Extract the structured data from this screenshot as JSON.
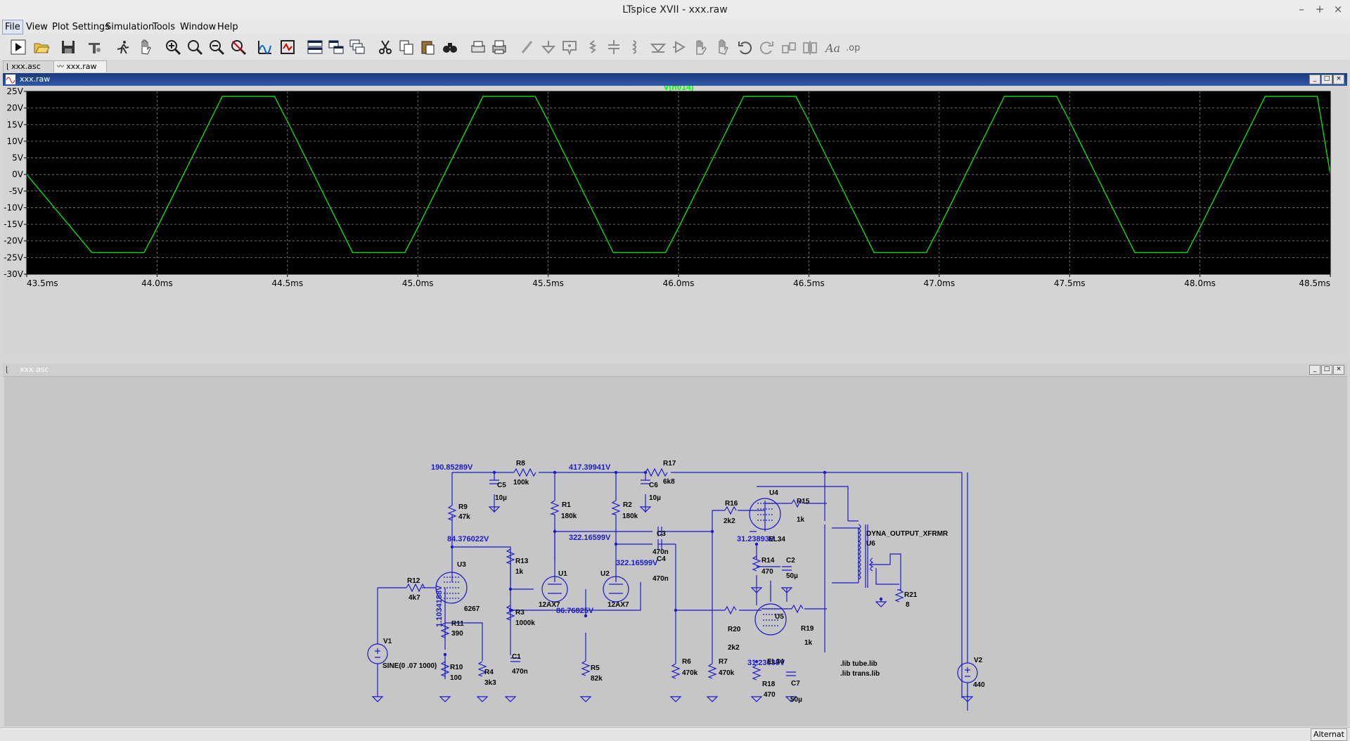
{
  "window": {
    "title": "LTspice XVII - xxx.raw",
    "minimize": "–",
    "maximize": "+",
    "close": "×"
  },
  "menu": [
    "File",
    "View",
    "Plot Settings",
    "Simulation",
    "Tools",
    "Window",
    "Help"
  ],
  "toolbar": {
    "icons": [
      "run-icon",
      "open-icon",
      "save-icon",
      "control-panel-icon",
      "halt-icon",
      "pan-icon",
      "zoom-in-icon",
      "zoom-area-icon",
      "zoom-out-icon",
      "zoom-fit-icon",
      "autorange-icon",
      "plot-settings-icon",
      "tile-horizontal-icon",
      "tile-vertical-icon",
      "cascade-icon",
      "cut-icon",
      "copy-icon",
      "paste-icon",
      "find-icon",
      "print-setup-icon",
      "print-icon",
      "wire-icon",
      "ground-icon",
      "label-net-icon",
      "resistor-icon",
      "capacitor-icon",
      "inductor-icon",
      "diode-icon",
      "component-icon",
      "move-icon",
      "drag-icon",
      "undo-icon",
      "redo-icon",
      "rotate-icon",
      "mirror-icon",
      "text-icon",
      "spice-directive-icon"
    ]
  },
  "tabs": [
    {
      "label": "xxx.asc",
      "active": false
    },
    {
      "label": "xxx.raw",
      "active": true
    }
  ],
  "waveform_window": {
    "title": "xxx.raw",
    "trace_name": "V(n014)",
    "trace_color": "#00ff00"
  },
  "chart_data": {
    "type": "line",
    "title": "V(n014)",
    "xlabel": "",
    "ylabel": "",
    "x_ticks": [
      "43.5ms",
      "44.0ms",
      "44.5ms",
      "45.0ms",
      "45.5ms",
      "46.0ms",
      "46.5ms",
      "47.0ms",
      "47.5ms",
      "48.0ms",
      "48.5ms"
    ],
    "y_ticks": [
      "25V",
      "20V",
      "15V",
      "10V",
      "5V",
      "0V",
      "-5V",
      "-10V",
      "-15V",
      "-20V",
      "-25V",
      "-30V"
    ],
    "xlim": [
      43.5,
      48.5
    ],
    "ylim": [
      -30,
      25
    ],
    "grid": true,
    "series": [
      {
        "name": "V(n014)",
        "color": "#00ff00",
        "x": [
          43.5,
          43.75,
          43.95,
          44.0,
          44.25,
          44.45,
          44.5,
          44.75,
          44.95,
          45.0,
          45.25,
          45.45,
          45.5,
          45.75,
          45.95,
          46.0,
          46.25,
          46.45,
          46.5,
          46.75,
          46.95,
          47.0,
          47.25,
          47.45,
          47.5,
          47.75,
          47.95,
          48.0,
          48.25,
          48.45,
          48.5
        ],
        "y": [
          0,
          -23.5,
          -23.5,
          -16,
          23.5,
          23.5,
          16,
          -23.5,
          -23.5,
          -16,
          23.5,
          23.5,
          16,
          -23.5,
          -23.5,
          -16,
          23.5,
          23.5,
          16,
          -23.5,
          -23.5,
          -16,
          23.5,
          23.5,
          16,
          -23.5,
          -23.5,
          -16,
          23.5,
          23.5,
          0
        ]
      }
    ]
  },
  "schematic_window": {
    "title": "xxx.asc",
    "node_labels": [
      "190.85289V",
      "417.39941V",
      "84.376022V",
      "322.16599V",
      "322.16599V",
      "86.76825V",
      "1.1034188V",
      "31.23893V",
      "31.23638V"
    ],
    "components": [
      {
        "ref": "R8",
        "value": "100k"
      },
      {
        "ref": "C5",
        "value": "10µ"
      },
      {
        "ref": "R17",
        "value": "6k8"
      },
      {
        "ref": "C6",
        "value": "10µ"
      },
      {
        "ref": "R9",
        "value": "47k"
      },
      {
        "ref": "R1",
        "value": "180k"
      },
      {
        "ref": "R2",
        "value": "180k"
      },
      {
        "ref": "R16",
        "value": "2k2"
      },
      {
        "ref": "U4",
        "value": "EL34"
      },
      {
        "ref": "R15",
        "value": "1k"
      },
      {
        "ref": "C3",
        "value": "470n"
      },
      {
        "ref": "C4",
        "value": "470n"
      },
      {
        "ref": "R13",
        "value": "1k"
      },
      {
        "ref": "U3",
        "value": "6267"
      },
      {
        "ref": "U1",
        "value": "12AX7"
      },
      {
        "ref": "U2",
        "value": "12AX7"
      },
      {
        "ref": "R12",
        "value": "4k7"
      },
      {
        "ref": "R3",
        "value": "1000k"
      },
      {
        "ref": "R11",
        "value": "390"
      },
      {
        "ref": "R14",
        "value": "470"
      },
      {
        "ref": "C2",
        "value": "50µ"
      },
      {
        "ref": "U6",
        "value": "DYNA_OUTPUT_XFRMR"
      },
      {
        "ref": "R21",
        "value": "8"
      },
      {
        "ref": "V1",
        "value": "SINE(0 .07 1000)"
      },
      {
        "ref": "R10",
        "value": "100"
      },
      {
        "ref": "R4",
        "value": "3k3"
      },
      {
        "ref": "C1",
        "value": "470n"
      },
      {
        "ref": "R5",
        "value": "82k"
      },
      {
        "ref": "R6",
        "value": "470k"
      },
      {
        "ref": "R7",
        "value": "470k"
      },
      {
        "ref": "R20",
        "value": "2k2"
      },
      {
        "ref": "U5",
        "value": "EL34"
      },
      {
        "ref": "R19",
        "value": "1k"
      },
      {
        "ref": "R18",
        "value": "470"
      },
      {
        "ref": "C7",
        "value": "50µ"
      },
      {
        "ref": "V2",
        "value": "440"
      }
    ],
    "directives": [
      ".lib tube.lib",
      ".lib trans.lib"
    ]
  },
  "status": {
    "right": "Alternat"
  }
}
